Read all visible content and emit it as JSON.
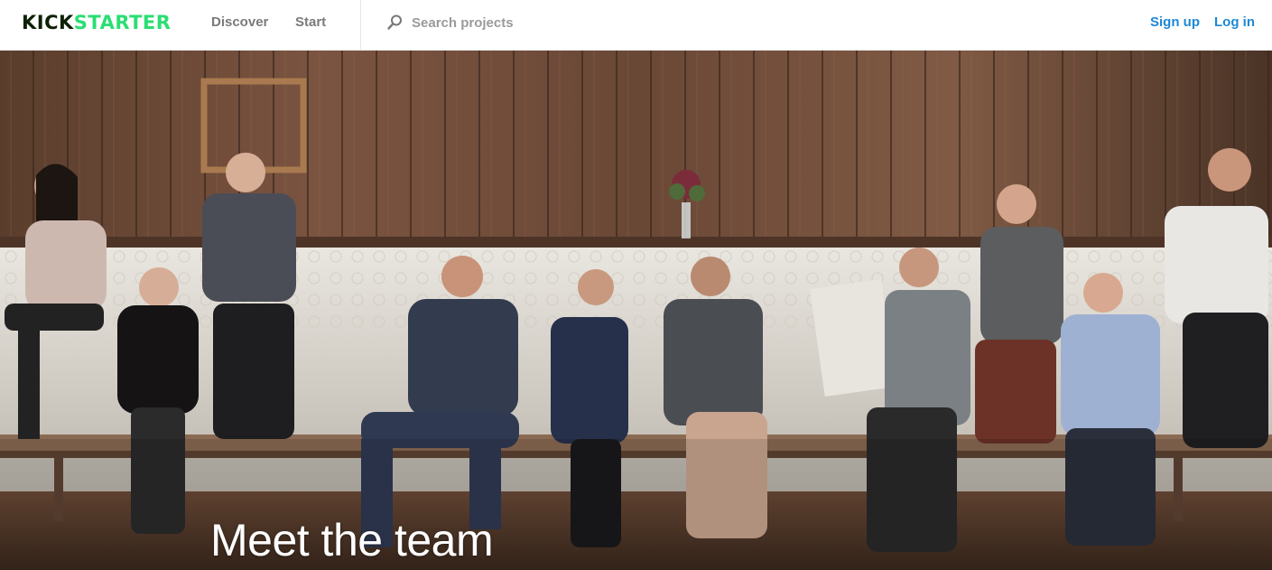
{
  "header": {
    "logo_part1": "KICK",
    "logo_part2": "STARTER",
    "nav": {
      "discover": "Discover",
      "start": "Start"
    },
    "search": {
      "placeholder": "Search projects",
      "value": "",
      "icon": "search-icon"
    },
    "auth": {
      "signup": "Sign up",
      "login": "Log in"
    }
  },
  "hero": {
    "title": "Meet the team",
    "image": "team-photo"
  },
  "colors": {
    "brand_dark": "#0f2105",
    "brand_green": "#2bde73",
    "link_blue": "#1e88d6",
    "nav_gray": "#7a7a7a"
  }
}
